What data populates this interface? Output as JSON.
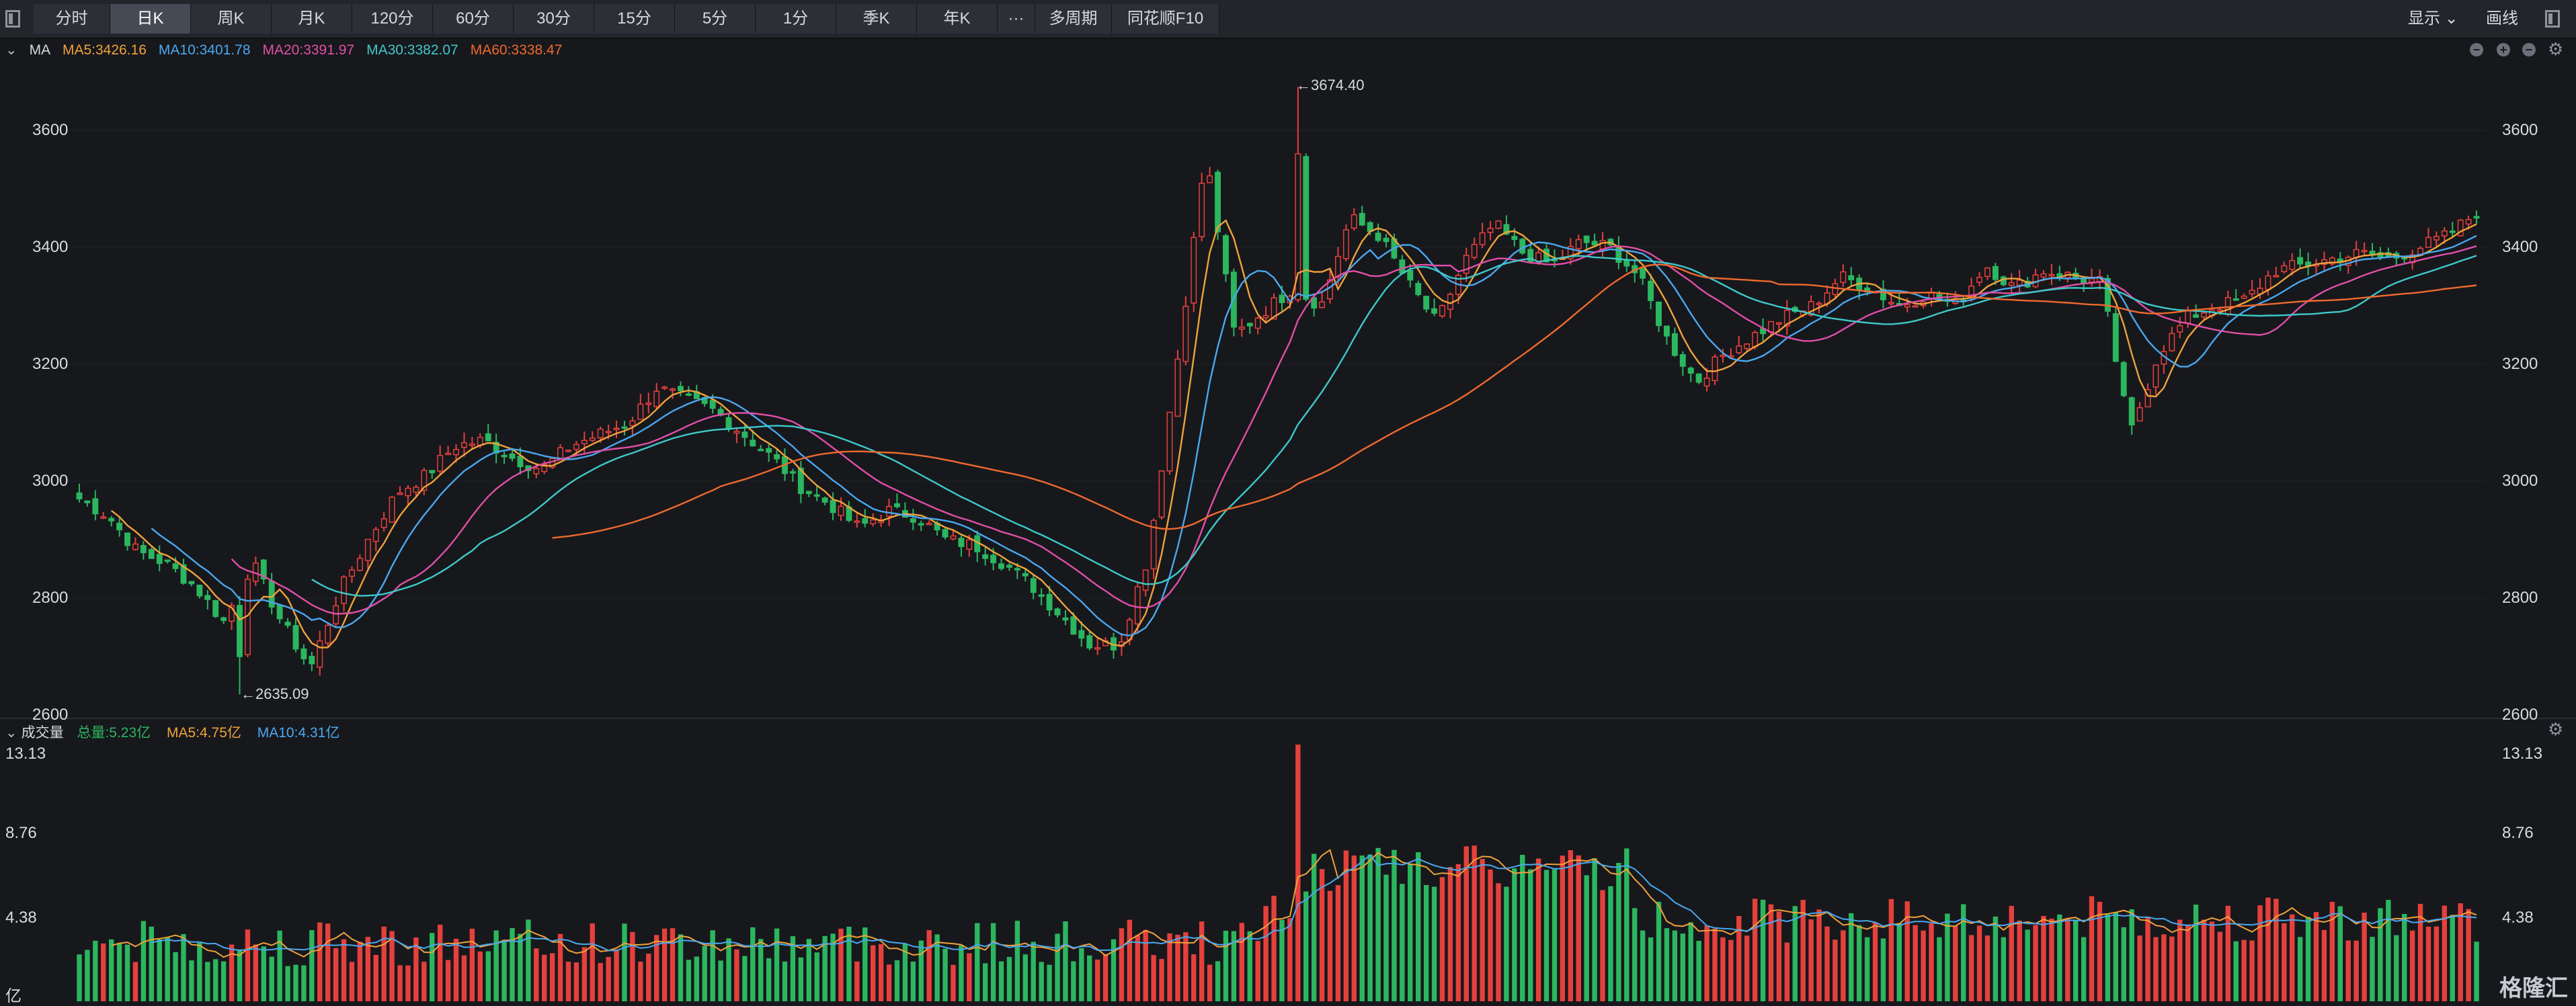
{
  "toolbar": {
    "tabs": [
      "分时",
      "日K",
      "周K",
      "月K",
      "120分",
      "60分",
      "30分",
      "15分",
      "5分",
      "1分",
      "季K",
      "年K",
      "···",
      "多周期",
      "同花顺F10"
    ],
    "active_tab": "日K",
    "display_label": "显示",
    "draw_label": "画线"
  },
  "price_panel": {
    "indicator_name": "MA",
    "ma_legend": [
      {
        "label": "MA5:3426.16",
        "color": "#f0a23b"
      },
      {
        "label": "MA10:3401.78",
        "color": "#4aa8f0"
      },
      {
        "label": "MA20:3391.97",
        "color": "#e04fa8"
      },
      {
        "label": "MA30:3382.07",
        "color": "#3ec9c9"
      },
      {
        "label": "MA60:3338.47",
        "color": "#ef6a2e"
      }
    ],
    "y_ticks": [
      "3600",
      "3400",
      "3200",
      "3000",
      "2800",
      "2600"
    ],
    "high_marker": "←3674.40",
    "low_marker": "←2635.09"
  },
  "volume_panel": {
    "title": "成交量",
    "total_label": "总量:5.23亿",
    "ma5_label": "MA5:4.75亿",
    "ma10_label": "MA10:4.31亿",
    "y_ticks": [
      "13.13",
      "8.76",
      "4.38"
    ],
    "unit": "亿"
  },
  "colors": {
    "up": "#e5403c",
    "down": "#2bb65f",
    "ma5": "#f0a23b",
    "ma10": "#4aa8f0",
    "ma20": "#e04fa8",
    "ma30": "#3ec9c9",
    "ma60": "#ef6a2e"
  },
  "watermark": "格隆汇",
  "chart_data": {
    "type": "candlestick",
    "candles_count": 300,
    "price_range": [
      2600,
      3700
    ],
    "price_high": 3674.4,
    "price_low": 2635.09,
    "volume_range": [
      0,
      13.13
    ],
    "volume_unit": "亿",
    "close_path": [
      2970,
      2940,
      2880,
      2860,
      2820,
      2760,
      2860,
      2760,
      2680,
      2810,
      2900,
      2980,
      3010,
      3060,
      3070,
      3040,
      3020,
      3060,
      3080,
      3100,
      3160,
      3140,
      3120,
      3080,
      3040,
      2990,
      2960,
      2920,
      2950,
      2940,
      2900,
      2890,
      2860,
      2820,
      2770,
      2720,
      2720,
      2870,
      3200,
      3560,
      3250,
      3290,
      3330,
      3300,
      3450,
      3420,
      3340,
      3270,
      3380,
      3440,
      3390,
      3370,
      3410,
      3400,
      3350,
      3240,
      3170,
      3220,
      3250,
      3280,
      3300,
      3350,
      3330,
      3300,
      3320,
      3300,
      3370,
      3330,
      3360,
      3350,
      3340,
      3080,
      3220,
      3280,
      3300,
      3310,
      3360,
      3370,
      3380,
      3390,
      3380,
      3400,
      3420,
      3460
    ]
  }
}
